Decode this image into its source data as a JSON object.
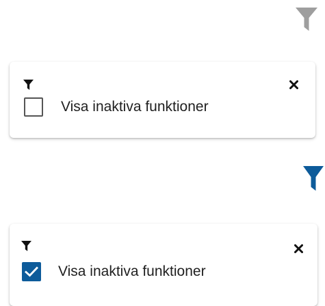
{
  "colors": {
    "filter_inactive": "#9e9e9e",
    "filter_active": "#0d5b9a",
    "icon_dark": "#111111",
    "checkbox_checked": "#0d5b9a"
  },
  "icons": {
    "filter": "filter-icon",
    "close": "close-icon",
    "check": "check-icon"
  },
  "state_unchecked": {
    "option": {
      "label": "Visa inaktiva funktioner",
      "checked": false
    }
  },
  "state_checked": {
    "option": {
      "label": "Visa inaktiva funktioner",
      "checked": true
    }
  }
}
